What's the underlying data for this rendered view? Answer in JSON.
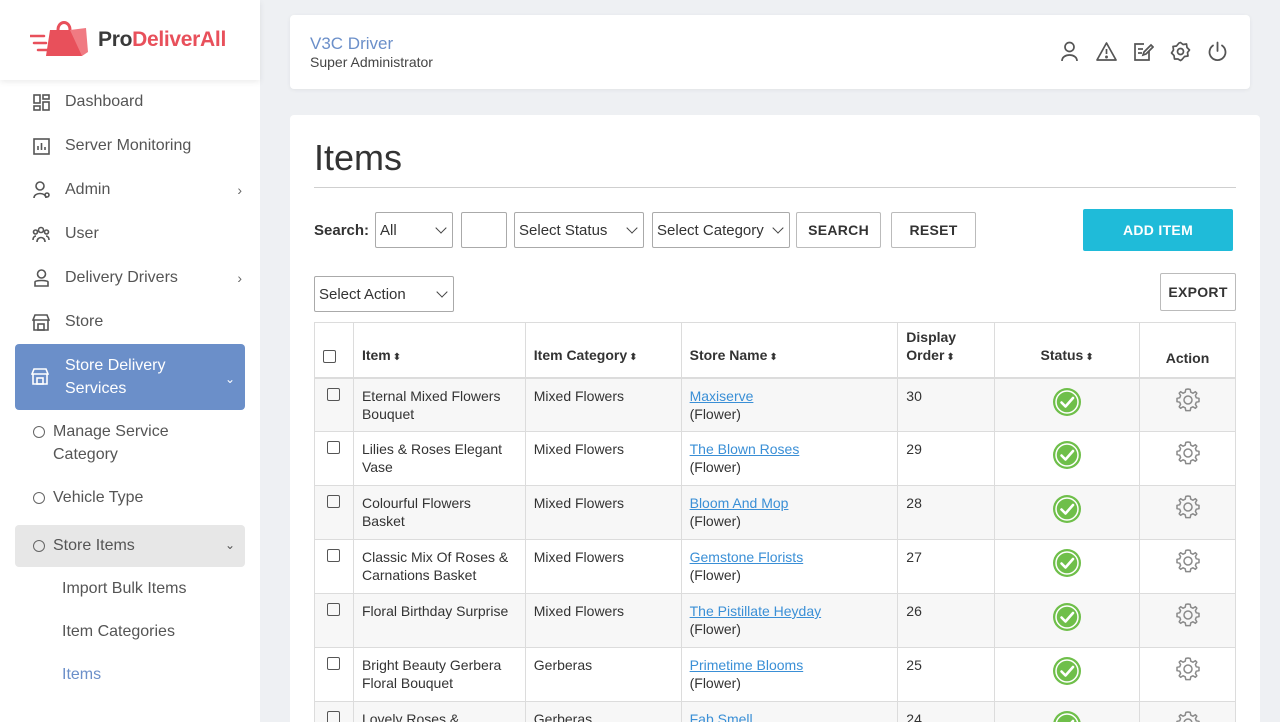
{
  "brand": {
    "pro": "Pro",
    "rest": "DeliverAll",
    "accent": "#e8505b"
  },
  "sidebar": {
    "items": [
      {
        "label": "Dashboard",
        "icon": "dashboard-icon"
      },
      {
        "label": "Server Monitoring",
        "icon": "chart-icon"
      },
      {
        "label": "Admin",
        "icon": "admin-user-icon",
        "chevron": "›"
      },
      {
        "label": "User",
        "icon": "users-group-icon"
      },
      {
        "label": "Delivery Drivers",
        "icon": "driver-icon",
        "chevron": "›"
      },
      {
        "label": "Store",
        "icon": "store-icon"
      }
    ],
    "active": {
      "line1": "Store Delivery",
      "line2": "Services",
      "icon": "store-icon",
      "chevron": "⌄"
    },
    "sub": [
      {
        "line1": "Manage Service",
        "line2": "Category"
      },
      {
        "line1": "Vehicle Type"
      }
    ],
    "store_items": {
      "label": "Store Items",
      "chevron": "⌄"
    },
    "subsub": [
      "Import Bulk Items",
      "Item Categories",
      "Items"
    ]
  },
  "header": {
    "name": "V3C Driver",
    "role": "Super Administrator",
    "icons": [
      "profile-icon",
      "alert-icon",
      "edit-note-icon",
      "settings-icon",
      "power-icon"
    ]
  },
  "page": {
    "title": "Items",
    "search_label": "Search:",
    "search_field": "All",
    "search_value": "",
    "status_select": "Select Status",
    "category_select": "Select Category",
    "search_button": "SEARCH",
    "reset_button": "RESET",
    "add_button": "ADD ITEM",
    "action_select": "Select Action",
    "export_button": "EXPORT"
  },
  "table": {
    "headers": {
      "item": "Item",
      "category": "Item Category",
      "store": "Store Name",
      "order_line1": "Display",
      "order_line2": "Order",
      "status": "Status",
      "action": "Action",
      "sort": "⬍"
    },
    "rows": [
      {
        "item": "Eternal Mixed Flowers Bouquet",
        "category": "Mixed Flowers",
        "store": "Maxiserve",
        "store_type": "(Flower)",
        "order": "30"
      },
      {
        "item": "Lilies & Roses Elegant Vase",
        "category": "Mixed Flowers",
        "store": "The Blown Roses",
        "store_type": "(Flower)",
        "order": "29"
      },
      {
        "item": "Colourful Flowers Basket",
        "category": "Mixed Flowers",
        "store": "Bloom And Mop",
        "store_type": "(Flower)",
        "order": "28"
      },
      {
        "item": "Classic Mix Of Roses & Carnations Basket",
        "category": "Mixed Flowers",
        "store": "Gemstone Florists",
        "store_type": "(Flower)",
        "order": "27"
      },
      {
        "item": "Floral Birthday Surprise",
        "category": "Mixed Flowers",
        "store": "The Pistillate Heyday",
        "store_type": "(Flower)",
        "order": "26"
      },
      {
        "item": "Bright Beauty Gerbera Floral Bouquet",
        "category": "Gerberas",
        "store": "Primetime Blooms",
        "store_type": "(Flower)",
        "order": "25"
      },
      {
        "item": "Lovely Roses &",
        "category": "Gerberas",
        "store": "Fab Smell",
        "store_type": "",
        "order": "24"
      }
    ]
  },
  "colors": {
    "active_nav": "#6b8fc9",
    "add_button": "#1fbbd9",
    "status_active": "#6fbf4a",
    "link": "#3a8fd6"
  }
}
